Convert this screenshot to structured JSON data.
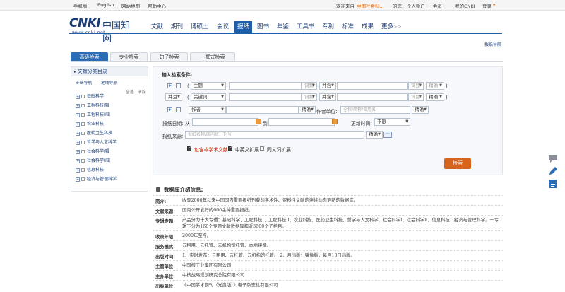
{
  "topbar": {
    "mobile": "手机版",
    "english": "English",
    "sitemap": "网站地图",
    "help": "帮助中心",
    "welcome": "欢迎来自",
    "org": "中国社会科...",
    "sep": "的您，",
    "personal": "个人账户",
    "member": "会员",
    "mycnki": "我的CNKI",
    "login": "登录"
  },
  "logo": {
    "brand": "CNKI",
    "cn": "中国知网",
    "url": "www.cnki.net"
  },
  "nav": {
    "items": [
      "文献",
      "期刊",
      "博硕士",
      "会议",
      "报纸",
      "图书",
      "年鉴",
      "工具书",
      "专利",
      "标准",
      "成果",
      "更多"
    ],
    "active_index": 4,
    "more_arrow": ">>"
  },
  "breadcrumb": "报纸导航",
  "tabs": [
    "高级检索",
    "专业检索",
    "句子检索",
    "一框式检索"
  ],
  "left_panel": {
    "title": "文献分类目录",
    "nav_a": "专辑导航",
    "nav_b": "地域导航",
    "select_all": "全选",
    "clear": "清除",
    "categories": [
      "基础科学",
      "工程科技Ⅰ辑",
      "工程科技Ⅱ辑",
      "农业科技",
      "医药卫生科技",
      "哲学与人文科学",
      "社会科学Ⅰ辑",
      "社会科学Ⅱ辑",
      "信息科技",
      "经济与管理科学"
    ]
  },
  "form": {
    "heading": "输入检索条件:",
    "row1": {
      "open": "(",
      "field": "主题",
      "freq": "词频",
      "logic": "并含",
      "freq2": "词频",
      "match": "精确",
      "close": ")"
    },
    "row2": {
      "op": "并且",
      "open": "(",
      "field": "关键词",
      "freq": "词频",
      "logic": "并含",
      "freq2": "词频",
      "match": "精确",
      "close": ")"
    },
    "row3": {
      "field": "作者",
      "match": "精确",
      "unit_label": "作者单位:",
      "unit_placeholder": "全称/简称/曾用名",
      "match2": "精确"
    },
    "date": {
      "label": "报纸日期:",
      "from": "从",
      "to": "到",
      "update_label": "更新时间:",
      "update_value": "不限"
    },
    "source": {
      "label": "报纸来源:",
      "placeholder": "报纸名称/国内统一刊号",
      "match": "精确"
    },
    "checks": [
      {
        "label": "包含非学术文献",
        "checked": true,
        "color": "#cc2200"
      },
      {
        "label": "中英文扩展",
        "checked": true,
        "color": "#333333"
      },
      {
        "label": "同义词扩展",
        "checked": false,
        "color": "#333333"
      }
    ],
    "search_button": "检索"
  },
  "info": {
    "title": "数据库介绍信息:",
    "rows": [
      {
        "k": "简介:",
        "v": "收录2000年以来中国国内重要报纸刊载的学术性、资料性文献的连续动态更新的数据库。"
      },
      {
        "k": "文献来源:",
        "v": "国内公开发行的600余种重要报纸。"
      },
      {
        "k": "专辑专题:",
        "v": "产品分为十大专辑：基础科学、工程科技Ⅰ、工程科技Ⅱ、农业科技、医药卫生科技、哲学与人文科学、社会科学Ⅰ、社会科学Ⅱ、信息科技、经济与管理科学。十专辑下分为168个专题文献数据库和近3600个子栏目。"
      },
      {
        "k": "收录年限:",
        "v": "2000年至今。"
      },
      {
        "k": "服务模式:",
        "v": "云租用、云托管、云机构馆托管、本地镜像。"
      },
      {
        "k": "出版时间:",
        "v": "1、实时发布：云租用、云托管、云机构馆托管。 2、月出版：镜像版，每月10日出版。"
      },
      {
        "k": "主管单位:",
        "v": "中国核工业集团有限公司"
      },
      {
        "k": "主办单位:",
        "v": "中核战略规划研究总院有限公司"
      },
      {
        "k": "出版单位:",
        "v": "《中国学术期刊（光盘版）》电子杂志社有限公司"
      }
    ]
  },
  "colors": {
    "brand": "#1f5ea8",
    "accent": "#d6641c"
  },
  "tools": [
    "comment-icon",
    "pen-icon",
    "note-icon"
  ]
}
